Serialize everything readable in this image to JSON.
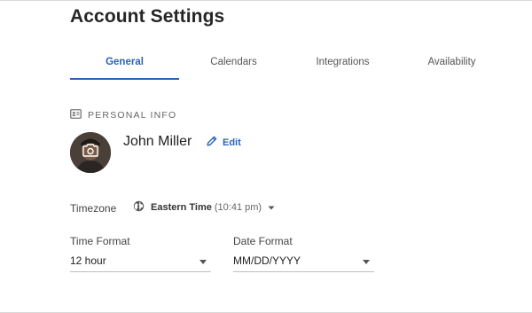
{
  "page": {
    "title": "Account Settings"
  },
  "tabs": [
    {
      "label": "General",
      "active": true
    },
    {
      "label": "Calendars",
      "active": false
    },
    {
      "label": "Integrations",
      "active": false
    },
    {
      "label": "Availability",
      "active": false
    }
  ],
  "personal_info": {
    "section_label": "PERSONAL INFO",
    "section_icon": "id-card-icon",
    "avatar_icon": "camera-icon",
    "name": "John Miller",
    "edit_label": "Edit",
    "edit_icon": "pencil-icon"
  },
  "timezone": {
    "label": "Timezone",
    "icon": "globe-icon",
    "value": "Eastern Time",
    "time": "(10:41 pm)"
  },
  "time_format": {
    "label": "Time Format",
    "value": "12 hour"
  },
  "date_format": {
    "label": "Date Format",
    "value": "MM/DD/YYYY"
  },
  "colors": {
    "accent": "#2a63b8",
    "text": "#262626",
    "muted": "#666666"
  }
}
